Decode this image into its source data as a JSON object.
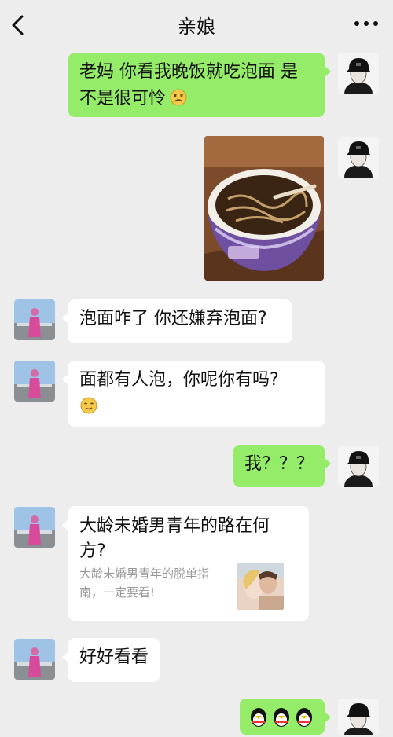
{
  "header": {
    "title": "亲娘"
  },
  "messages": {
    "m1": {
      "text": "老妈 你看我晚饭就吃泡面 是不是很可怜",
      "emoji": "sad-face-emoji"
    },
    "m2": {
      "image": "instant-noodle-cup-photo"
    },
    "m3": {
      "text": "泡面咋了 你还嫌弃泡面?"
    },
    "m4": {
      "text": "面都有人泡，你呢你有吗?",
      "emoji": "smiling-face-emoji"
    },
    "m5": {
      "text": "我？？？"
    },
    "m6": {
      "link_title": "大龄未婚男青年的路在何方?",
      "link_desc": "大龄未婚男青年的脱单指南，一定要看!"
    },
    "m7": {
      "text": "好好看看"
    },
    "m8": {
      "emoji": "penguin-emoji"
    }
  },
  "colors": {
    "background": "#ededed",
    "sent_bubble": "#95ec69",
    "received_bubble": "#ffffff",
    "link_desc_text": "#999999"
  }
}
